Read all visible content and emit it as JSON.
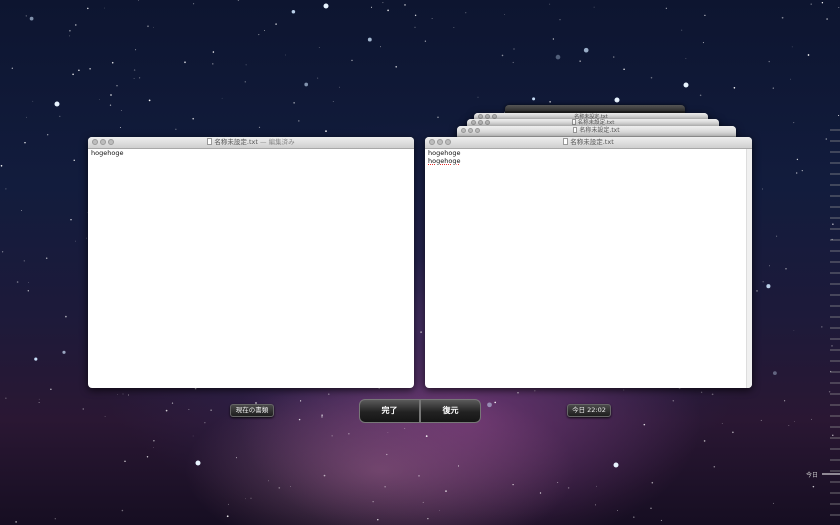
{
  "current_window": {
    "title": "名称未設定.txt",
    "title_suffix": "— 編集済み",
    "content": "hogehoge"
  },
  "backup_window": {
    "title": "名称未設定.txt",
    "lines": [
      "hogehoge",
      "hogehoge"
    ]
  },
  "stacked_windows": [
    {
      "title": "名称未設定.txt"
    },
    {
      "title": "名称未設定.txt"
    },
    {
      "title": "名称未設定.txt"
    }
  ],
  "labels": {
    "current_document": "現在の書類",
    "backup_time": "今日 22:02"
  },
  "buttons": {
    "done": "完了",
    "restore": "復元"
  },
  "timeline": {
    "label": "今日"
  },
  "colors": {
    "misspelling_underline": "#e03030"
  }
}
